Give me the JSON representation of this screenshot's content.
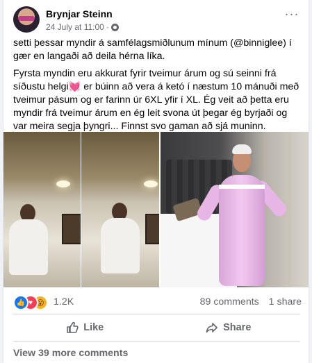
{
  "post": {
    "author": "Brynjar Steinn",
    "timestamp": "24 July at 11:00",
    "separator": "·",
    "privacy_icon": "globe-icon",
    "more_icon": "ellipsis-icon",
    "paragraph_1": "setti þessar myndir á samfélagsmiðlunum mínum (@binniglee) í gær en langaði að deila hérna líka.",
    "paragraph_2": "Fyrsta myndin eru akkurat fyrir tveimur árum og sú seinni frá síðustu helgi💓 er búinn að vera á ketó í næstum 10 mánuði með tveimur pásum og er farinn úr 6XL yfir í XL. Ég veit að þetta eru myndir frá tveimur árum en ég leit svona út þegar ég byrjaði og var meira segja þyngri... Finnst svo gaman að sjá muninn."
  },
  "reactions": {
    "types": [
      "like",
      "love",
      "wow"
    ],
    "count": "1.2K",
    "comments": "89 comments",
    "shares": "1 share"
  },
  "actions": {
    "like_label": "Like",
    "share_label": "Share"
  },
  "footer": {
    "view_more": "View 39 more comments"
  },
  "colors": {
    "accent": "#1877f2",
    "love": "#f33e58",
    "wow": "#f7b125",
    "secondary_text": "#65676b"
  }
}
